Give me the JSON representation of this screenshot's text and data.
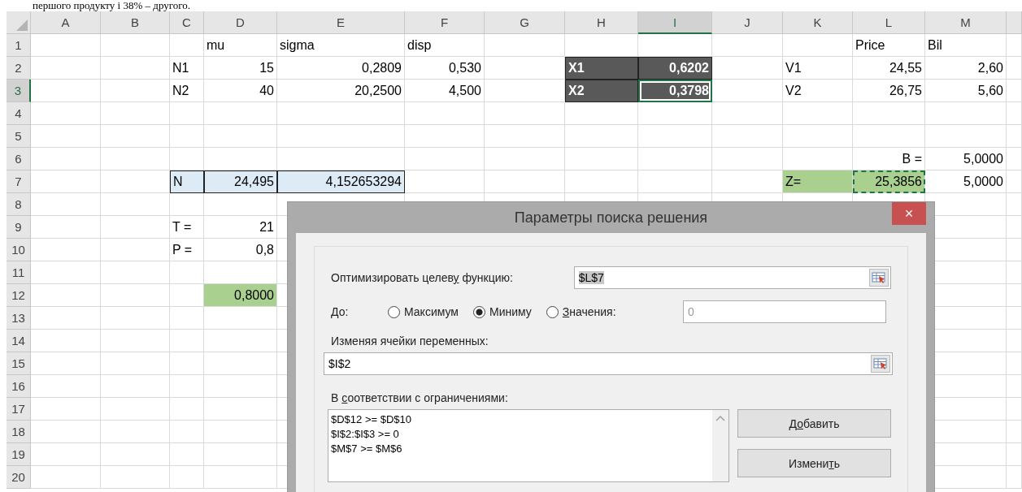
{
  "top_text": "першого продукту і 38% – другого.",
  "columns": [
    {
      "label": "A",
      "selected": false
    },
    {
      "label": "B",
      "selected": false
    },
    {
      "label": "C",
      "selected": false
    },
    {
      "label": "D",
      "selected": false
    },
    {
      "label": "E",
      "selected": false
    },
    {
      "label": "F",
      "selected": false
    },
    {
      "label": "G",
      "selected": false
    },
    {
      "label": "H",
      "selected": false
    },
    {
      "label": "I",
      "selected": true
    },
    {
      "label": "J",
      "selected": false
    },
    {
      "label": "K",
      "selected": false
    },
    {
      "label": "L",
      "selected": false
    },
    {
      "label": "M",
      "selected": false
    }
  ],
  "rows": [
    {
      "number": "1",
      "selected": false,
      "cells": [
        null,
        null,
        null,
        {
          "text": "mu",
          "kind": "text",
          "bordered": false,
          "copied": false,
          "selected": false
        },
        {
          "text": "sigma",
          "kind": "text",
          "bordered": false,
          "copied": false,
          "selected": false
        },
        {
          "text": "disp",
          "kind": "text",
          "bordered": false,
          "copied": false,
          "selected": false
        },
        null,
        null,
        null,
        null,
        null,
        {
          "text": "Price",
          "kind": "text",
          "bordered": false,
          "copied": false,
          "selected": false
        },
        {
          "text": "Bil",
          "kind": "text",
          "bordered": false,
          "copied": false,
          "selected": false
        }
      ]
    },
    {
      "number": "2",
      "selected": false,
      "cells": [
        null,
        null,
        {
          "text": "N1",
          "kind": "text",
          "bordered": false,
          "copied": false,
          "selected": false
        },
        {
          "text": "15",
          "kind": "number",
          "bordered": false,
          "copied": false,
          "selected": false
        },
        {
          "text": "0,2809",
          "kind": "number",
          "bordered": false,
          "copied": false,
          "selected": false
        },
        {
          "text": "0,530",
          "kind": "number",
          "bordered": false,
          "copied": false,
          "selected": false
        },
        null,
        {
          "text": "X1",
          "kind": "text",
          "color": "#595959",
          "bordered": true,
          "copied": false,
          "selected": false
        },
        {
          "text": "0,6202",
          "kind": "number",
          "color": "#595959",
          "bordered": true,
          "copied": false,
          "selected": false
        },
        null,
        {
          "text": "V1",
          "kind": "text",
          "bordered": false,
          "copied": false,
          "selected": false
        },
        {
          "text": "24,55",
          "kind": "number",
          "bordered": false,
          "copied": false,
          "selected": false
        },
        {
          "text": "2,60",
          "kind": "number",
          "bordered": false,
          "copied": false,
          "selected": false
        }
      ]
    },
    {
      "number": "3",
      "selected": true,
      "cells": [
        null,
        null,
        {
          "text": "N2",
          "kind": "text",
          "bordered": false,
          "copied": false,
          "selected": false
        },
        {
          "text": "40",
          "kind": "number",
          "bordered": false,
          "copied": false,
          "selected": false
        },
        {
          "text": "20,2500",
          "kind": "number",
          "bordered": false,
          "copied": false,
          "selected": false
        },
        {
          "text": "4,500",
          "kind": "number",
          "bordered": false,
          "copied": false,
          "selected": false
        },
        null,
        {
          "text": "X2",
          "kind": "text",
          "color": "#595959",
          "bordered": true,
          "copied": false,
          "selected": false
        },
        {
          "text": "0,3798",
          "kind": "number",
          "color": "#595959",
          "bordered": true,
          "copied": false,
          "selected": true
        },
        null,
        {
          "text": "V2",
          "kind": "text",
          "bordered": false,
          "copied": false,
          "selected": false
        },
        {
          "text": "26,75",
          "kind": "number",
          "bordered": false,
          "copied": false,
          "selected": false
        },
        {
          "text": "5,60",
          "kind": "number",
          "bordered": false,
          "copied": false,
          "selected": false
        }
      ]
    },
    {
      "number": "4",
      "selected": false,
      "cells": []
    },
    {
      "number": "5",
      "selected": false,
      "cells": []
    },
    {
      "number": "6",
      "selected": false,
      "cells": [
        null,
        null,
        null,
        null,
        null,
        null,
        null,
        null,
        null,
        null,
        null,
        {
          "text": "B =",
          "kind": "number",
          "bordered": false,
          "copied": false,
          "selected": false
        },
        {
          "text": "5,0000",
          "kind": "number",
          "bordered": false,
          "copied": false,
          "selected": false
        }
      ]
    },
    {
      "number": "7",
      "selected": false,
      "cells": [
        null,
        null,
        {
          "text": "N",
          "kind": "text",
          "color": "#ddebf7",
          "bordered": true,
          "copied": false,
          "selected": false
        },
        {
          "text": "24,495",
          "kind": "number",
          "color": "#ddebf7",
          "bordered": true,
          "copied": false,
          "selected": false
        },
        {
          "text": "4,152653294",
          "kind": "number",
          "color": "#ddebf7",
          "bordered": true,
          "copied": false,
          "selected": false
        },
        null,
        null,
        null,
        null,
        null,
        {
          "text": "Z=",
          "kind": "text",
          "color": "#a9d08e",
          "bordered": false,
          "copied": false,
          "selected": false
        },
        {
          "text": "25,3856",
          "kind": "number",
          "color": "#a9d08e",
          "bordered": false,
          "copied": true,
          "selected": false
        },
        {
          "text": "5,0000",
          "kind": "number",
          "bordered": false,
          "copied": false,
          "selected": false
        }
      ]
    },
    {
      "number": "8",
      "selected": false,
      "cells": []
    },
    {
      "number": "9",
      "selected": false,
      "cells": [
        null,
        null,
        {
          "text": "T =",
          "kind": "text",
          "bordered": false,
          "copied": false,
          "selected": false
        },
        {
          "text": "21",
          "kind": "number",
          "bordered": false,
          "copied": false,
          "selected": false
        }
      ]
    },
    {
      "number": "10",
      "selected": false,
      "cells": [
        null,
        null,
        {
          "text": "P =",
          "kind": "text",
          "bordered": false,
          "copied": false,
          "selected": false
        },
        {
          "text": "0,8",
          "kind": "number",
          "bordered": false,
          "copied": false,
          "selected": false
        }
      ]
    },
    {
      "number": "11",
      "selected": false,
      "cells": []
    },
    {
      "number": "12",
      "selected": false,
      "cells": [
        null,
        null,
        null,
        {
          "text": "0,8000",
          "kind": "number",
          "color": "#a9d08e",
          "bordered": false,
          "copied": false,
          "selected": false
        }
      ]
    },
    {
      "number": "13",
      "selected": false,
      "cells": []
    },
    {
      "number": "14",
      "selected": false,
      "cells": []
    },
    {
      "number": "15",
      "selected": false,
      "cells": []
    },
    {
      "number": "16",
      "selected": false,
      "cells": []
    },
    {
      "number": "17",
      "selected": false,
      "cells": []
    },
    {
      "number": "18",
      "selected": false,
      "cells": []
    },
    {
      "number": "19",
      "selected": false,
      "cells": []
    },
    {
      "number": "20",
      "selected": false,
      "cells": []
    }
  ],
  "dialog": {
    "title": "Параметры поиска решения",
    "close": "×",
    "objective": {
      "label": {
        "before": "Оптимизировать целев",
        "key": "у",
        "after": " функцию:"
      },
      "value": "$L$7",
      "text_selected": true
    },
    "to": {
      "label": "До:",
      "options": [
        {
          "label": {
            "after": "Максимум"
          },
          "selected": false
        },
        {
          "label": {
            "after": "Миниму"
          },
          "selected": true
        },
        {
          "label": {
            "key": "З",
            "after": "начения:"
          },
          "selected": false
        }
      ],
      "value": "0",
      "disabled": true
    },
    "variables": {
      "label": "Изменяя ячейки переменных:",
      "value": "$I$2"
    },
    "constraints": {
      "label": {
        "before": "В ",
        "key": "с",
        "after": "оответствии с ограничениями:"
      },
      "items": [
        "$D$12 >= $D$10",
        "$I$2:$I$3 >= 0",
        "$M$7 >= $M$6"
      ]
    },
    "buttons": [
      {
        "label": {
          "before": "Д",
          "key": "о",
          "after": "бавить"
        }
      },
      {
        "label": {
          "before": "Измени",
          "key": "т",
          "after": "ь"
        }
      }
    ]
  }
}
